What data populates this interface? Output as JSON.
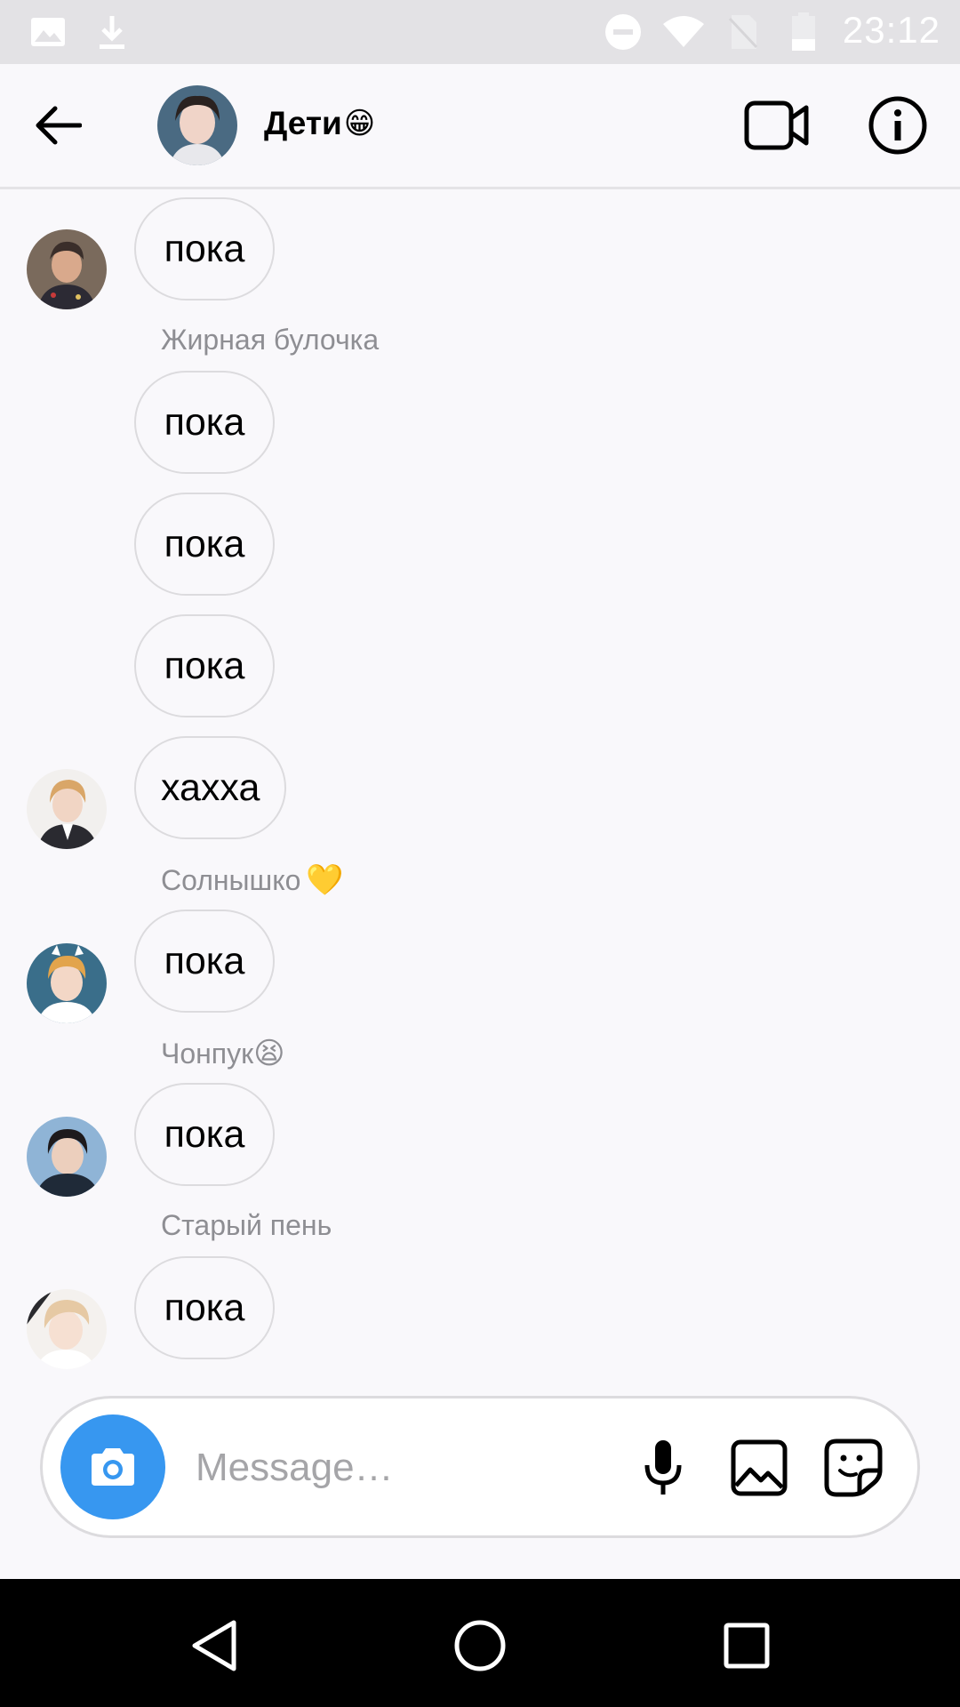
{
  "status_bar": {
    "time": "23:12",
    "icons": [
      "image-notification-icon",
      "download-icon",
      "do-not-disturb-icon",
      "wifi-icon",
      "no-sim-icon",
      "battery-icon"
    ]
  },
  "header": {
    "title": "Дети",
    "title_emoji": "😁",
    "icons": [
      "back-arrow-icon",
      "video-call-icon",
      "info-icon"
    ]
  },
  "messages": [
    {
      "sender": "",
      "sender_emoji": "",
      "text": "пока"
    },
    {
      "sender": "Жирная булочка",
      "sender_emoji": "",
      "text": "пока"
    },
    {
      "sender": "",
      "sender_emoji": "",
      "text": "пока"
    },
    {
      "sender": "",
      "sender_emoji": "",
      "text": "пока"
    },
    {
      "sender": "",
      "sender_emoji": "",
      "text": "хахха"
    },
    {
      "sender": "Солнышко",
      "sender_emoji": "💛",
      "text": "пока"
    },
    {
      "sender": "Чонпук",
      "sender_emoji": "😫",
      "text": "пока"
    },
    {
      "sender": "Старый пень",
      "sender_emoji": "",
      "text": "пока"
    }
  ],
  "composer": {
    "placeholder": "Message…",
    "icons": [
      "camera-icon",
      "microphone-icon",
      "gallery-icon",
      "sticker-icon"
    ]
  },
  "nav_bar": {
    "icons": [
      "back-triangle-icon",
      "home-circle-icon",
      "recents-square-icon"
    ]
  },
  "colors": {
    "accent": "#3797f0",
    "background": "#f9f8fb",
    "status_bar": "#e3e2e5",
    "secondary_text": "#8e8e93"
  }
}
